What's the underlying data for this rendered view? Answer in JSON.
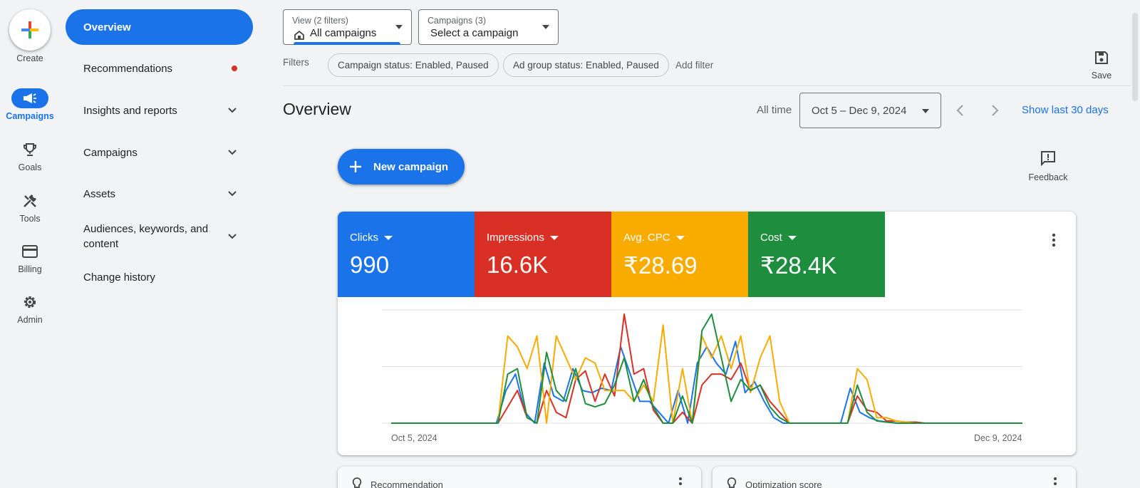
{
  "rail": {
    "create_label": "Create",
    "items": [
      {
        "label": "Campaigns",
        "icon": "megaphone-icon",
        "active": true
      },
      {
        "label": "Goals",
        "icon": "trophy-icon"
      },
      {
        "label": "Tools",
        "icon": "tools-icon"
      },
      {
        "label": "Billing",
        "icon": "credit-card-icon"
      },
      {
        "label": "Admin",
        "icon": "gear-icon"
      }
    ]
  },
  "nav": {
    "items": [
      {
        "label": "Overview",
        "active": true
      },
      {
        "label": "Recommendations",
        "badge": "dot"
      },
      {
        "label": "Insights and reports",
        "expandable": true
      },
      {
        "label": "Campaigns",
        "expandable": true
      },
      {
        "label": "Assets",
        "expandable": true
      },
      {
        "label": "Audiences, keywords, and content",
        "expandable": true
      },
      {
        "label": "Change history"
      }
    ]
  },
  "header": {
    "view_selector": {
      "small": "View (2 filters)",
      "value": "All campaigns"
    },
    "campaign_selector": {
      "small": "Campaigns (3)",
      "value": "Select a campaign"
    },
    "filters_label": "Filters",
    "chips": [
      "Campaign status: Enabled, Paused",
      "Ad group status: Enabled, Paused"
    ],
    "add_filter": "Add filter",
    "save_label": "Save"
  },
  "main": {
    "title": "Overview",
    "date_range_label": "All time",
    "date_range": "Oct 5 – Dec 9, 2024",
    "show_last": "Show last 30 days",
    "new_campaign": "New campaign",
    "feedback": "Feedback"
  },
  "metrics": [
    {
      "name": "Clicks",
      "value": "990",
      "color": "#1a73e8"
    },
    {
      "name": "Impressions",
      "value": "16.6K",
      "color": "#d93025"
    },
    {
      "name": "Avg. CPC",
      "value": "₹28.69",
      "color": "#f9ab00"
    },
    {
      "name": "Cost",
      "value": "₹28.4K",
      "color": "#1e8e3e"
    }
  ],
  "chart_data": {
    "type": "line",
    "x_start": "Oct 5, 2024",
    "x_end": "Dec 9, 2024",
    "grid": true,
    "note_scale": "each series normalized to its own max (1.0 = peak)",
    "series": [
      {
        "name": "Clicks",
        "color": "#1a73e8",
        "values": [
          0,
          0,
          0,
          0,
          0,
          0,
          0,
          0,
          0,
          0,
          0,
          0,
          0.3,
          0.45,
          0.1,
          0,
          0.55,
          0.25,
          0.2,
          0.5,
          0.3,
          0.28,
          0.32,
          0.3,
          0.7,
          0.45,
          0.2,
          0.2,
          0.1,
          0,
          0.3,
          0,
          0.55,
          0.7,
          0.55,
          0.45,
          0.75,
          0.28,
          0.38,
          0.2,
          0.05,
          0,
          0,
          0,
          0,
          0,
          0,
          0,
          0.32,
          0.1,
          0.05,
          0.02,
          0.01,
          0,
          0,
          0,
          0,
          0,
          0,
          0,
          0,
          0,
          0,
          0,
          0,
          0,
          0
        ]
      },
      {
        "name": "Impressions",
        "color": "#d93025",
        "values": [
          0,
          0,
          0,
          0,
          0,
          0,
          0,
          0,
          0,
          0,
          0,
          0,
          0.15,
          0.3,
          0.05,
          0,
          0.3,
          0.1,
          0.05,
          0.4,
          0.48,
          0.2,
          0.45,
          0.25,
          1.0,
          0.45,
          0.5,
          0.12,
          0,
          0,
          0.1,
          0,
          0.35,
          0.45,
          0.45,
          0.4,
          0.55,
          0.3,
          0.35,
          0.2,
          0.1,
          0,
          0,
          0,
          0,
          0,
          0,
          0,
          0.25,
          0.12,
          0.1,
          0.02,
          0.02,
          0.01,
          0.01,
          0,
          0,
          0,
          0,
          0,
          0,
          0,
          0,
          0,
          0,
          0
        ]
      },
      {
        "name": "Avg. CPC",
        "color": "#f9ab00",
        "values": [
          0,
          0,
          0,
          0,
          0,
          0,
          0,
          0,
          0,
          0,
          0,
          0,
          0.8,
          0.7,
          0.5,
          0.8,
          0,
          0.8,
          0.6,
          0.4,
          0.6,
          0.55,
          0.3,
          0.3,
          0.3,
          0.2,
          0.35,
          0.2,
          0.9,
          0,
          0.5,
          0,
          0.8,
          0.6,
          0.8,
          0.5,
          0.8,
          0.28,
          0.6,
          0.8,
          0.2,
          0,
          0,
          0,
          0,
          0,
          0,
          0,
          0.5,
          0.4,
          0.05,
          0.05,
          0.02,
          0.01,
          0,
          0,
          0,
          0,
          0,
          0,
          0,
          0,
          0,
          0,
          0,
          0
        ]
      },
      {
        "name": "Cost",
        "color": "#1e8e3e",
        "values": [
          0,
          0,
          0,
          0,
          0,
          0,
          0,
          0,
          0,
          0,
          0,
          0,
          0.45,
          0.5,
          0.05,
          0,
          0.65,
          0.3,
          0.2,
          0.5,
          0.18,
          0.15,
          0.18,
          0.35,
          0.6,
          0.2,
          0.4,
          0.15,
          0,
          0,
          0.25,
          0,
          0.85,
          1.0,
          0.6,
          0.2,
          0.4,
          0.3,
          0.35,
          0.15,
          0.05,
          0,
          0,
          0,
          0,
          0,
          0,
          0,
          0.35,
          0.1,
          0.02,
          0.01,
          0,
          0,
          0,
          0,
          0,
          0,
          0,
          0,
          0,
          0,
          0,
          0,
          0,
          0
        ]
      }
    ]
  },
  "cards": [
    {
      "title": "Recommendation"
    },
    {
      "title": "Optimization score"
    }
  ]
}
